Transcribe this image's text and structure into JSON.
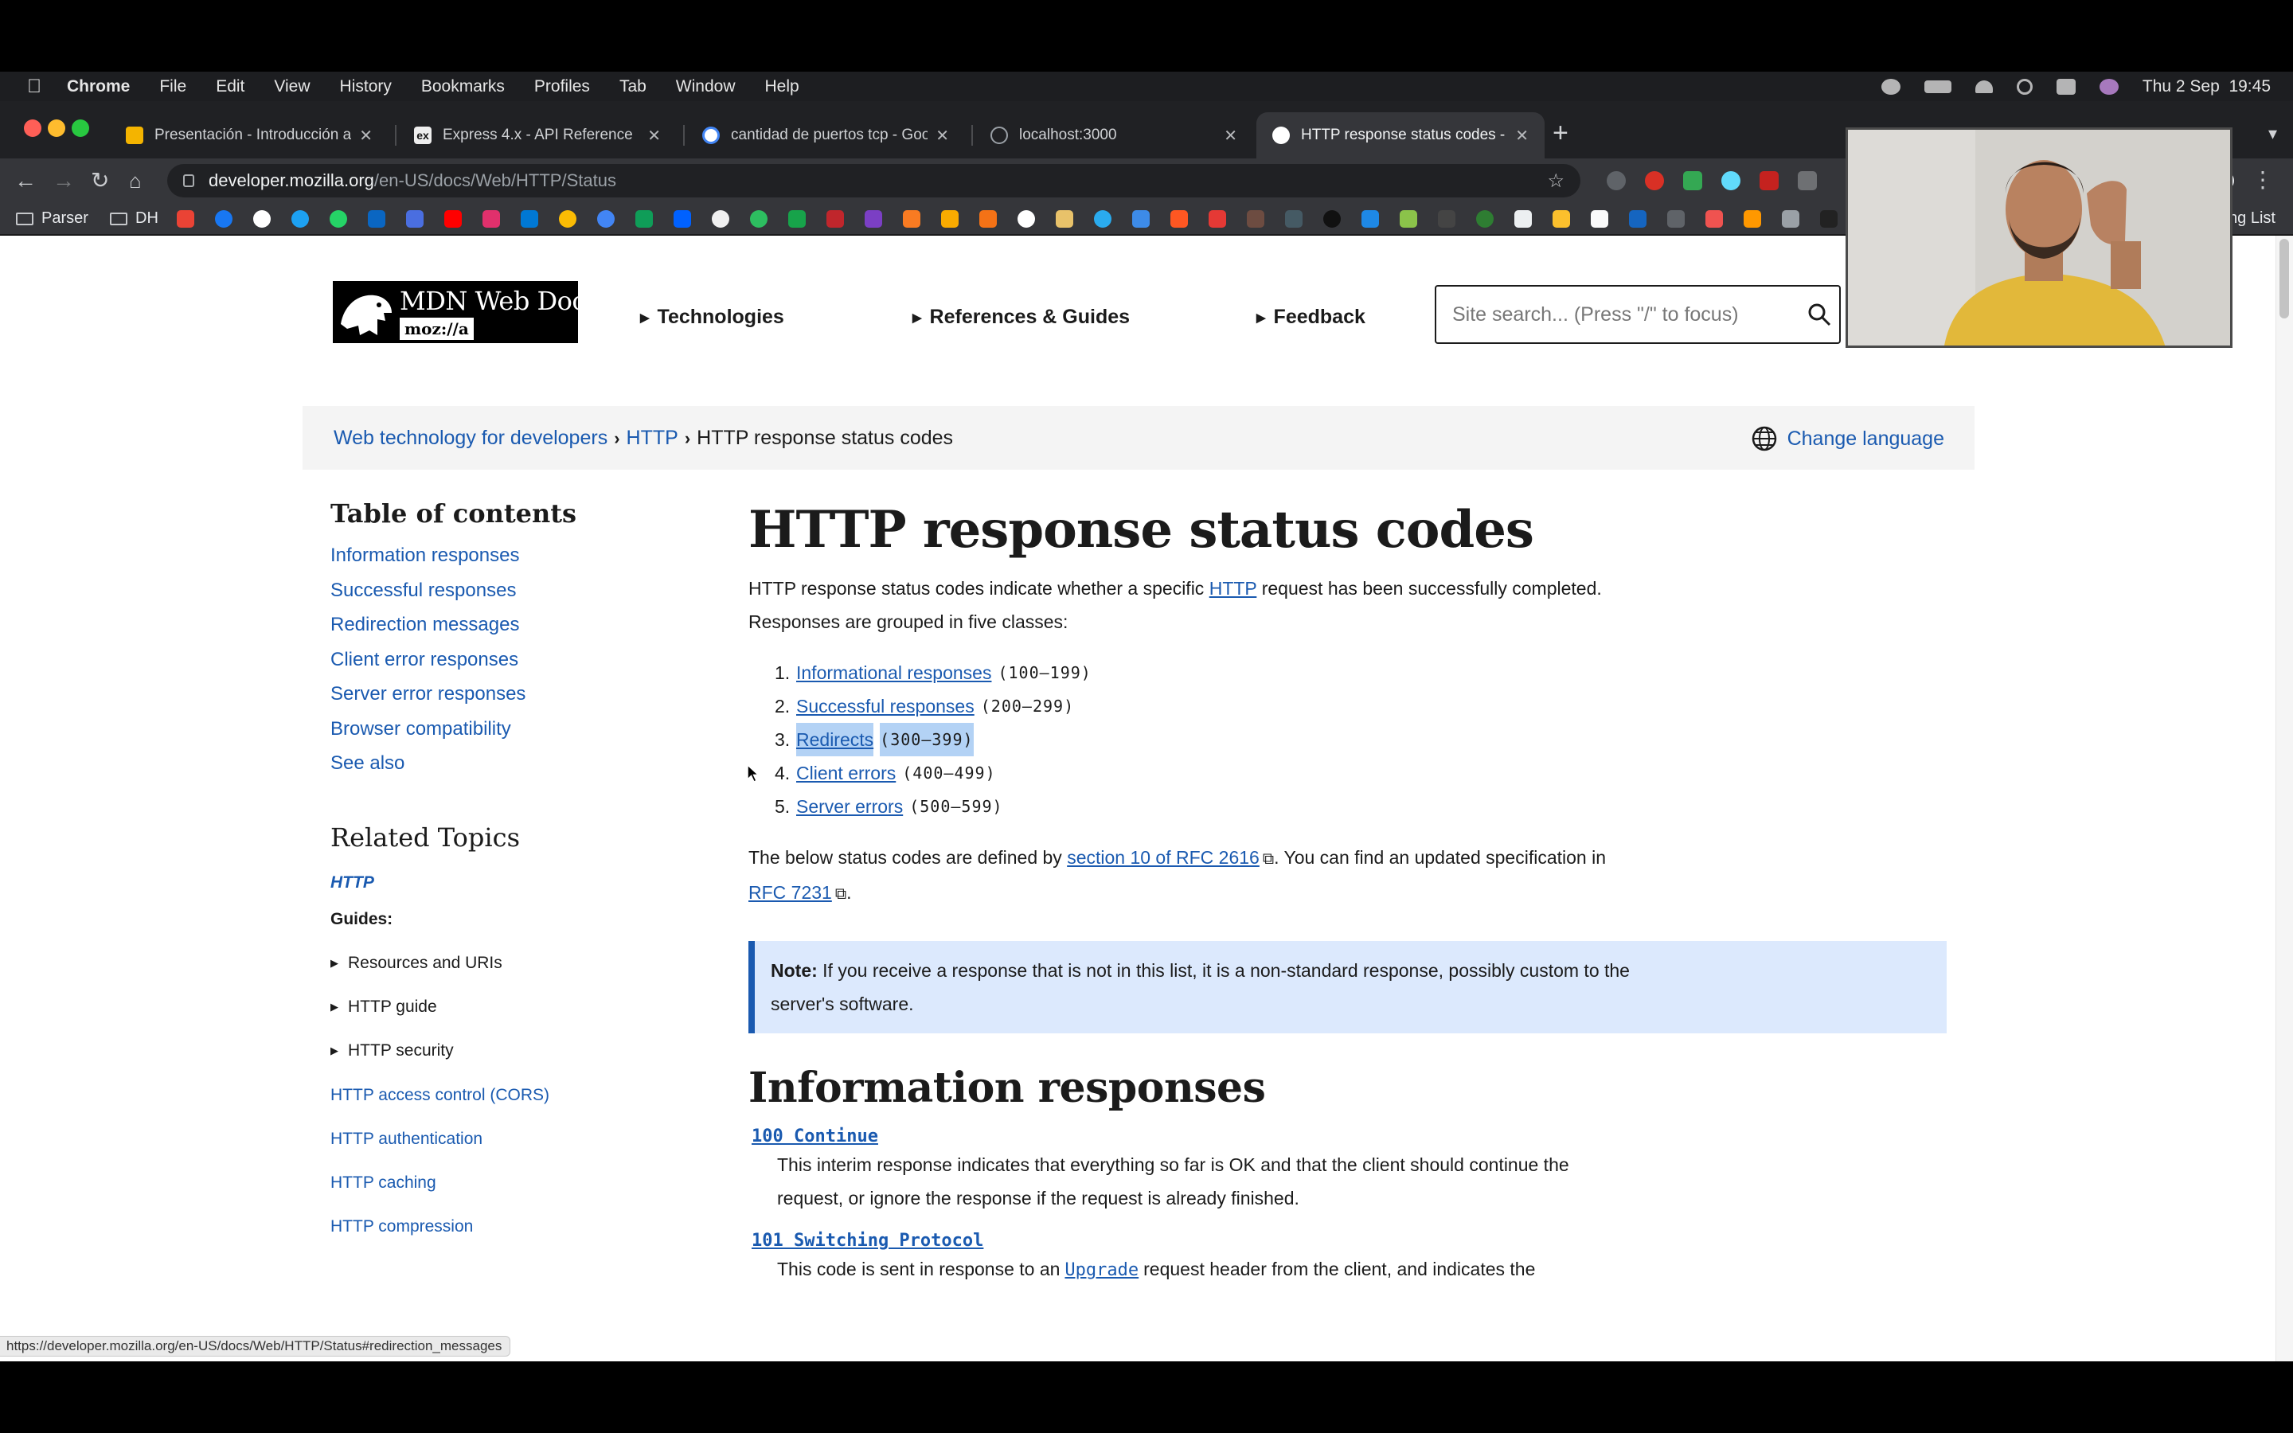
{
  "menubar": {
    "app": "Chrome",
    "items": [
      "File",
      "Edit",
      "View",
      "History",
      "Bookmarks",
      "Profiles",
      "Tab",
      "Window",
      "Help"
    ],
    "datetime": "Thu 2 Sep  19:45"
  },
  "tabs": [
    {
      "label": "Presentación - Introducción a",
      "favicon_color": "#f4b400"
    },
    {
      "label": "Express 4.x - API Reference",
      "favicon_color": "#eeeeee"
    },
    {
      "label": "cantidad de puertos tcp - Goo",
      "favicon_color": "#4285f4"
    },
    {
      "label": "localhost:3000",
      "favicon_color": "#9aa0a6"
    },
    {
      "label": "HTTP response status codes -",
      "favicon_color": "#ffffff"
    }
  ],
  "toolbar": {
    "url_host": "developer.mozilla.org",
    "url_path": "/en-US/docs/Web/HTTP/Status"
  },
  "bookmarks": {
    "folder1": "Parser",
    "folder2": "DH",
    "reading_list": "ng List"
  },
  "mdn": {
    "logo_title": "MDN Web Docs",
    "logo_sub": "moz://a",
    "nav": [
      "Technologies",
      "References & Guides",
      "Feedback"
    ],
    "search_placeholder": "Site search... (Press \"/\" to focus)"
  },
  "breadcrumb": {
    "items": [
      "Web technology for developers",
      "HTTP"
    ],
    "current": "HTTP response status codes",
    "change_language": "Change language"
  },
  "sidebar": {
    "toc_title": "Table of contents",
    "toc": [
      "Information responses",
      "Successful responses",
      "Redirection messages",
      "Client error responses",
      "Server error responses",
      "Browser compatibility",
      "See also"
    ],
    "related_title": "Related Topics",
    "http_link": "HTTP",
    "guides_label": "Guides:",
    "groups": [
      "Resources and URIs",
      "HTTP guide",
      "HTTP security"
    ],
    "links": [
      "HTTP access control (CORS)",
      "HTTP authentication",
      "HTTP caching",
      "HTTP compression"
    ]
  },
  "article": {
    "title": "HTTP response status codes",
    "intro_1": "HTTP response status codes indicate whether a specific ",
    "intro_link": "HTTP",
    "intro_2": " request has been successfully completed. Responses are grouped in five classes:",
    "classes": [
      {
        "num": "1.",
        "label": "Informational responses",
        "range": "(100–199)"
      },
      {
        "num": "2.",
        "label": "Successful responses",
        "range": "(200–299)"
      },
      {
        "num": "3.",
        "label": "Redirects",
        "range": "(300–399)"
      },
      {
        "num": "4.",
        "label": "Client errors",
        "range": "(400–499)"
      },
      {
        "num": "5.",
        "label": "Server errors",
        "range": "(500–599)"
      }
    ],
    "spec_1": "The below status codes are defined by ",
    "spec_link1": "section 10 of RFC 2616",
    "spec_2": ". You can find an updated specification in ",
    "spec_link2": "RFC 7231",
    "spec_3": ".",
    "note_label": "Note:",
    "note_text": " If you receive a response that is not in this list, it is a non-standard response, possibly custom to the server's software.",
    "section_title": "Information responses",
    "codes": [
      {
        "term": "100 Continue",
        "desc": "This interim response indicates that everything so far is OK and that the client should continue the request, or ignore the response if the request is already finished."
      },
      {
        "term": "101 Switching Protocol",
        "desc_1": "This code is sent in response to an",
        "desc_inline": "Upgrade",
        "desc_2": "request header from the client, and indicates the"
      }
    ]
  },
  "status_url": "https://developer.mozilla.org/en-US/docs/Web/HTTP/Status#redirection_messages"
}
